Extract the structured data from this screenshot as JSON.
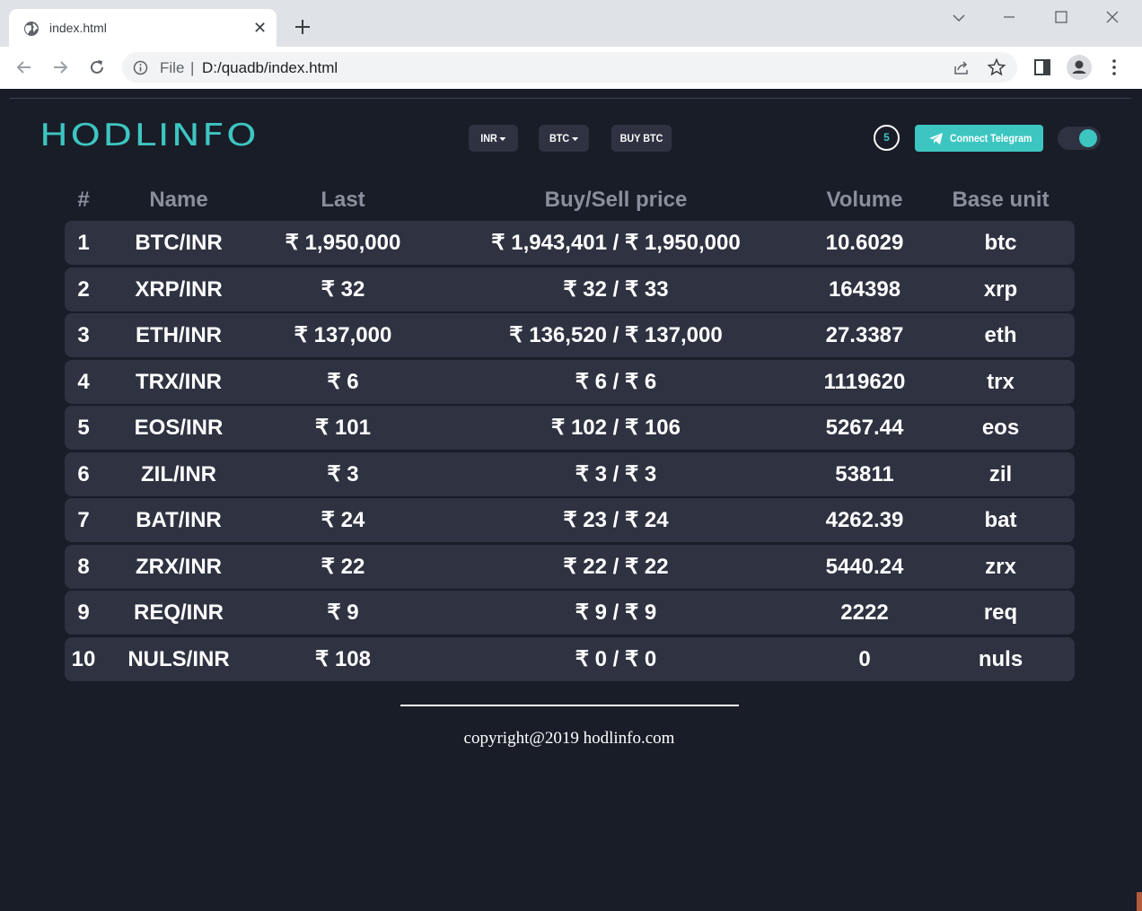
{
  "browser": {
    "tab_title": "index.html",
    "tab_close": "✕",
    "address_scheme": "File",
    "address_separator": "|",
    "address_url": "D:/quadb/index.html"
  },
  "header": {
    "logo": "HODLINFO",
    "currency_select": "INR",
    "coin_select": "BTC",
    "buy_button": "BUY BTC",
    "timer": "5",
    "telegram_button": "Connect Telegram",
    "theme_toggle_on": true,
    "accent_color": "#3dc6c1"
  },
  "table": {
    "columns": [
      "#",
      "Name",
      "Last",
      "Buy/Sell price",
      "Volume",
      "Base unit"
    ],
    "rows": [
      {
        "idx": "1",
        "name": "BTC/INR",
        "last": "₹ 1,950,000",
        "buy_sell": "₹ 1,943,401 / ₹ 1,950,000",
        "volume": "10.6029",
        "base": "btc"
      },
      {
        "idx": "2",
        "name": "XRP/INR",
        "last": "₹ 32",
        "buy_sell": "₹ 32 / ₹ 33",
        "volume": "164398",
        "base": "xrp"
      },
      {
        "idx": "3",
        "name": "ETH/INR",
        "last": "₹ 137,000",
        "buy_sell": "₹ 136,520 / ₹ 137,000",
        "volume": "27.3387",
        "base": "eth"
      },
      {
        "idx": "4",
        "name": "TRX/INR",
        "last": "₹ 6",
        "buy_sell": "₹ 6 / ₹ 6",
        "volume": "1119620",
        "base": "trx"
      },
      {
        "idx": "5",
        "name": "EOS/INR",
        "last": "₹ 101",
        "buy_sell": "₹ 102 / ₹ 106",
        "volume": "5267.44",
        "base": "eos"
      },
      {
        "idx": "6",
        "name": "ZIL/INR",
        "last": "₹ 3",
        "buy_sell": "₹ 3 / ₹ 3",
        "volume": "53811",
        "base": "zil"
      },
      {
        "idx": "7",
        "name": "BAT/INR",
        "last": "₹ 24",
        "buy_sell": "₹ 23 / ₹ 24",
        "volume": "4262.39",
        "base": "bat"
      },
      {
        "idx": "8",
        "name": "ZRX/INR",
        "last": "₹ 22",
        "buy_sell": "₹ 22 / ₹ 22",
        "volume": "5440.24",
        "base": "zrx"
      },
      {
        "idx": "9",
        "name": "REQ/INR",
        "last": "₹ 9",
        "buy_sell": "₹ 9 / ₹ 9",
        "volume": "2222",
        "base": "req"
      },
      {
        "idx": "10",
        "name": "NULS/INR",
        "last": "₹ 108",
        "buy_sell": "₹ 0 / ₹ 0",
        "volume": "0",
        "base": "nuls"
      }
    ]
  },
  "footer": {
    "copyright": "copyright@2019 hodlinfo.com"
  }
}
